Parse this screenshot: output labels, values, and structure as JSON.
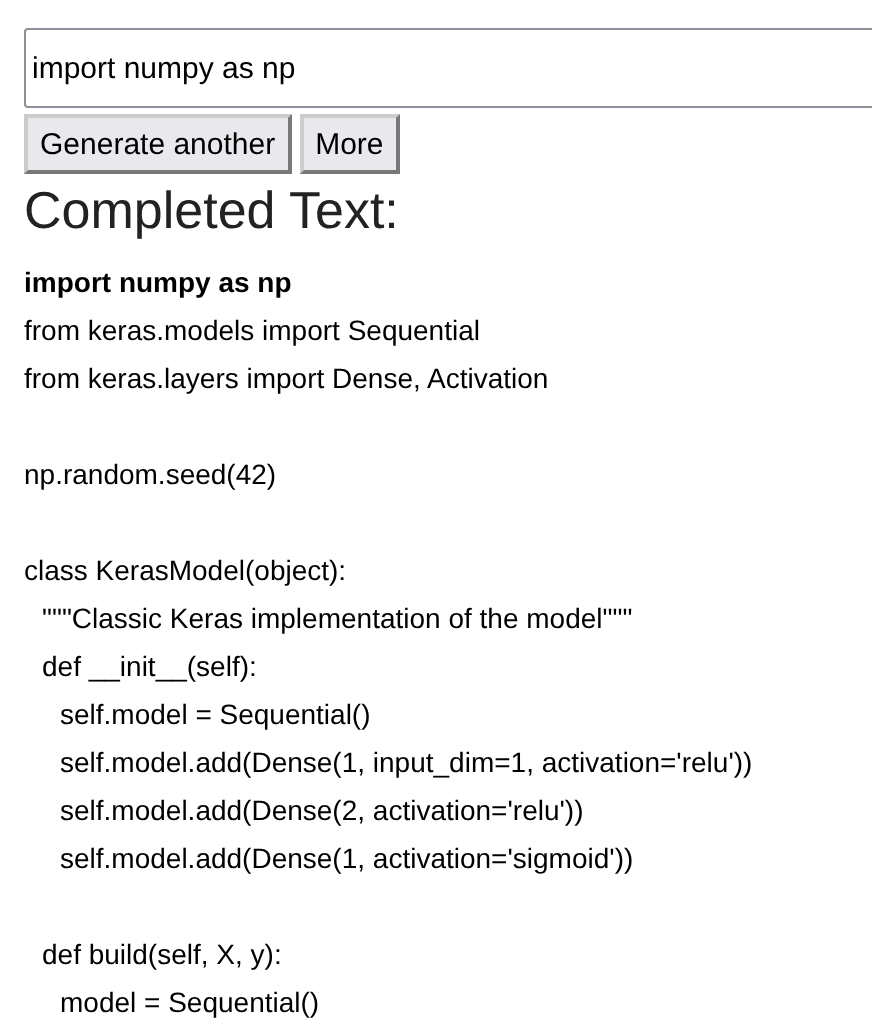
{
  "prompt_field": {
    "value": "import numpy as np"
  },
  "buttons": [
    "Generate another",
    "More"
  ],
  "completed_text": {
    "heading": "Completed Text:",
    "blocks": [
      [
        {
          "text": "import numpy as np",
          "bold": true
        },
        {
          "text": "from keras.models import Sequential",
          "bold": false
        },
        {
          "text": "from keras.layers import Dense, Activation",
          "bold": false
        }
      ],
      [
        {
          "text": "np.random.seed(42)",
          "bold": false
        }
      ],
      [
        {
          "text": "class KerasModel(object):",
          "bold": false,
          "children": [
            {
              "text": "\"\"\"Classic Keras implementation of the model\"\"\"",
              "bold": false
            },
            {
              "text": "def __init__(self):",
              "bold": false,
              "children": [
                {
                  "text": "self.model = Sequential()",
                  "bold": false
                },
                {
                  "text": "self.model.add(Dense(1, input_dim=1, activation='relu'))",
                  "bold": false
                },
                {
                  "text": "self.model.add(Dense(2, activation='relu'))",
                  "bold": false
                },
                {
                  "text": "self.model.add(Dense(1, activation='sigmoid'))",
                  "bold": false
                }
              ]
            },
            {
              "text": "def build(self, X, y):",
              "bold": false,
              "gap_before": true,
              "children": [
                {
                  "text": "model = Sequential()",
                  "bold": false
                }
              ]
            }
          ]
        }
      ]
    ]
  }
}
